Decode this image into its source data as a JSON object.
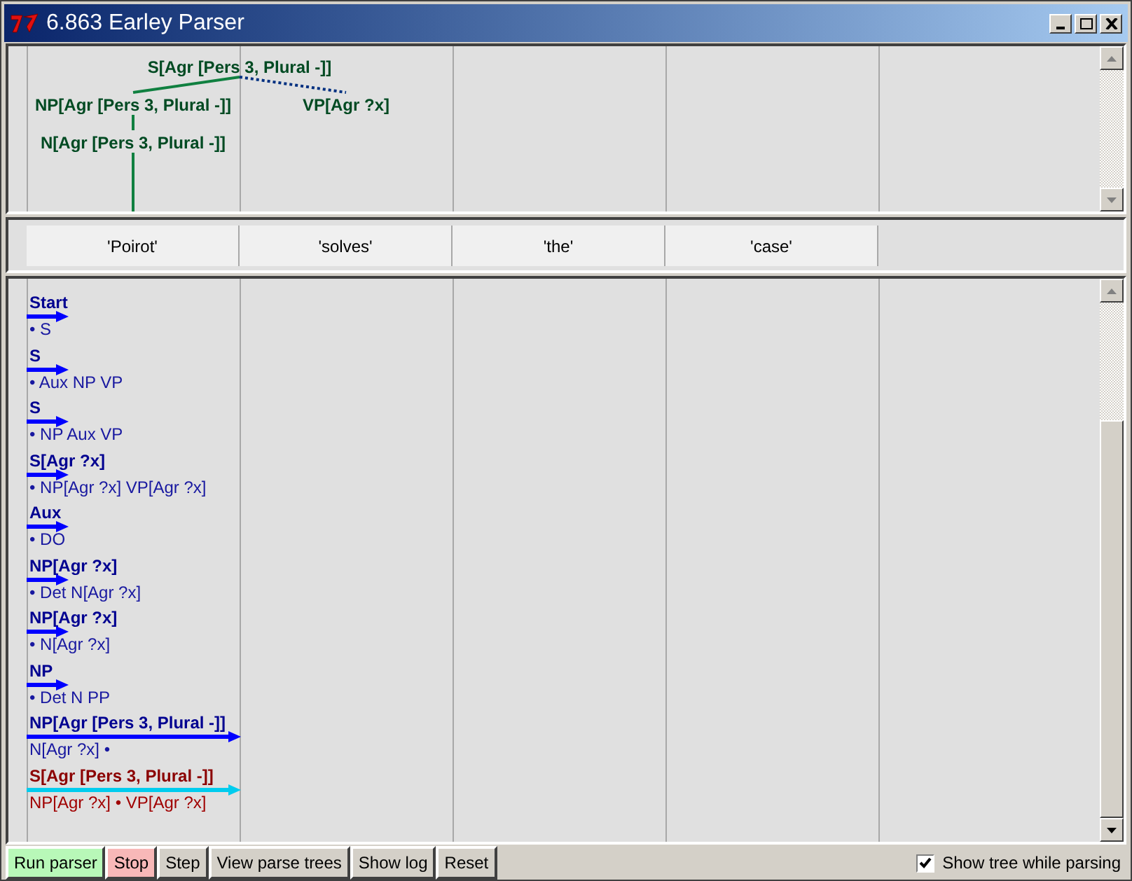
{
  "window": {
    "title": "6.863 Earley Parser"
  },
  "tree": {
    "label": "S[Agr [Pers 3, Plural -]]",
    "children": [
      {
        "label": "NP[Agr [Pers 3, Plural -]]",
        "complete": true,
        "children": [
          {
            "label": "N[Agr [Pers 3, Plural -]]",
            "complete": true
          }
        ]
      },
      {
        "label": "VP[Agr ?x]",
        "complete": false
      }
    ]
  },
  "words": [
    "'Poirot'",
    "'solves'",
    "'the'",
    "'case'"
  ],
  "edges": [
    {
      "lhs": "Start",
      "rhs": "• S",
      "kind": "predicted",
      "color": "#0000ff",
      "selected": false
    },
    {
      "lhs": "S",
      "rhs": "• Aux NP VP",
      "kind": "predicted",
      "color": "#0000ff",
      "selected": false
    },
    {
      "lhs": "S",
      "rhs": "• NP Aux VP",
      "kind": "predicted",
      "color": "#0000ff",
      "selected": false
    },
    {
      "lhs": "S[Agr ?x]",
      "rhs": "• NP[Agr ?x] VP[Agr ?x]",
      "kind": "predicted",
      "color": "#0000ff",
      "selected": false
    },
    {
      "lhs": "Aux",
      "rhs": "• DO",
      "kind": "predicted",
      "color": "#0000ff",
      "selected": false
    },
    {
      "lhs": "NP[Agr ?x]",
      "rhs": "• Det N[Agr ?x]",
      "kind": "predicted",
      "color": "#0000ff",
      "selected": false
    },
    {
      "lhs": "NP[Agr ?x]",
      "rhs": "• N[Agr ?x]",
      "kind": "predicted",
      "color": "#0000ff",
      "selected": false
    },
    {
      "lhs": "NP",
      "rhs": "• Det N PP",
      "kind": "predicted",
      "color": "#0000ff",
      "selected": false
    },
    {
      "lhs": "NP[Agr [Pers 3, Plural -]]",
      "rhs": "N[Agr ?x] •",
      "kind": "spanning",
      "color": "#0000ff",
      "selected": false
    },
    {
      "lhs": "S[Agr [Pers 3, Plural -]]",
      "rhs": "NP[Agr ?x] • VP[Agr ?x]",
      "kind": "spanning",
      "color": "#00ccee",
      "selected": true
    }
  ],
  "buttons": [
    {
      "label": "Run parser",
      "color": "#b8f8b8"
    },
    {
      "label": "Stop",
      "color": "#f8b8b8"
    },
    {
      "label": "Step",
      "color": "#d4d0c8"
    },
    {
      "label": "View parse trees",
      "color": "#d4d0c8"
    },
    {
      "label": "Show log",
      "color": "#d4d0c8"
    },
    {
      "label": "Reset",
      "color": "#d4d0c8"
    }
  ],
  "show_tree": {
    "label": "Show tree while parsing",
    "checked": true
  }
}
